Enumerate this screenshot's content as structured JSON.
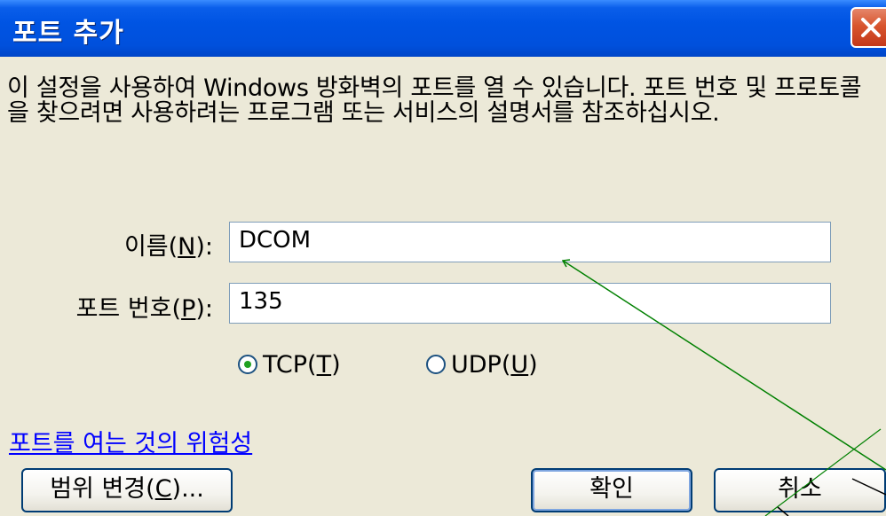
{
  "window": {
    "title": "포트 추가"
  },
  "description": "이 설정을 사용하여 Windows 방화벽의 포트를 열 수 있습니다. 포트 번호 및 프로토콜을 찾으려면 사용하려는 프로그램 또는 서비스의 설명서를 참조하십시오.",
  "name_field": {
    "label_prefix": "이름(",
    "label_key": "N",
    "label_suffix": "):",
    "value": "DCOM"
  },
  "port_field": {
    "label_prefix": "포트 번호(",
    "label_key": "P",
    "label_suffix": "):",
    "value": "135"
  },
  "protocol": {
    "tcp": {
      "prefix": "TCP(",
      "key": "T",
      "suffix": ")",
      "selected": true
    },
    "udp": {
      "prefix": "UDP(",
      "key": "U",
      "suffix": ")",
      "selected": false
    }
  },
  "risk_link": "포트를 여는 것의 위험성",
  "buttons": {
    "change_scope": {
      "prefix": "범위 변경(",
      "key": "C",
      "suffix": ")..."
    },
    "ok": "확인",
    "cancel": "취소"
  },
  "colors": {
    "titlebar": "#0054E3",
    "dialog_bg": "#ECE9D8",
    "close": "#D8552E",
    "link": "#0000FF",
    "annotation": "#008000"
  }
}
